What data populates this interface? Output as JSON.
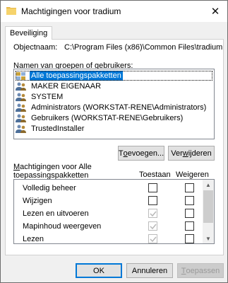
{
  "window": {
    "title": "Machtigingen voor tradium"
  },
  "tabs": [
    {
      "label": "Beveiliging"
    }
  ],
  "object": {
    "label": "Objectnaam:",
    "path": "C:\\Program Files (x86)\\Common Files\\tradium"
  },
  "groups": {
    "label_prefix": "",
    "label_underline": "N",
    "label_rest": "amen van groepen of gebruikers:",
    "items": [
      {
        "name": "Alle toepassingspakketten",
        "icon": "app-packages-icon",
        "selected": true
      },
      {
        "name": "MAKER EIGENAAR",
        "icon": "users-icon"
      },
      {
        "name": "SYSTEM",
        "icon": "users-icon"
      },
      {
        "name": "Administrators (WORKSTAT-RENE\\Administrators)",
        "icon": "users-icon"
      },
      {
        "name": "Gebruikers (WORKSTAT-RENE\\Gebruikers)",
        "icon": "users-icon"
      },
      {
        "name": "TrustedInstaller",
        "icon": "users-icon"
      }
    ]
  },
  "buttons": {
    "add_pre": "T",
    "add_u": "o",
    "add_rest": "evoegen...",
    "remove_pre": "Ver",
    "remove_u": "w",
    "remove_rest": "ijderen",
    "ok": "OK",
    "cancel": "Annuleren",
    "apply_u": "T",
    "apply_rest": "oepassen"
  },
  "permissions": {
    "label_u": "M",
    "label_rest": "achtigingen voor Alle",
    "label_line2": "toepassingspakketten",
    "allow_header": "Toestaan",
    "deny_header": "Weigeren",
    "rows": [
      {
        "name": "Volledig beheer",
        "allow": false,
        "allow_disabled": false,
        "deny": false
      },
      {
        "name": "Wijzigen",
        "allow": false,
        "allow_disabled": false,
        "deny": false
      },
      {
        "name": "Lezen en uitvoeren",
        "allow": true,
        "allow_disabled": true,
        "deny": false
      },
      {
        "name": "Mapinhoud weergeven",
        "allow": true,
        "allow_disabled": true,
        "deny": false
      },
      {
        "name": "Lezen",
        "allow": true,
        "allow_disabled": true,
        "deny": false
      }
    ]
  },
  "colors": {
    "selection": "#0078d7",
    "window_bg": "#f0f0f0"
  }
}
